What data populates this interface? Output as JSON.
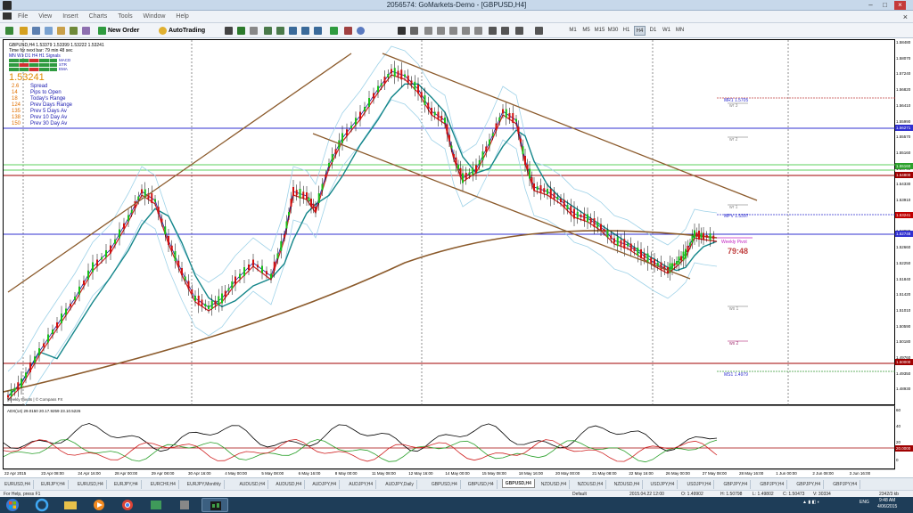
{
  "window": {
    "title": "2056574: GoMarkets-Demo - [GBPUSD,H4]"
  },
  "menu": [
    "File",
    "View",
    "Insert",
    "Charts",
    "Tools",
    "Window",
    "Help"
  ],
  "toolbar": {
    "new_order": "New Order",
    "autotrading": "AutoTrading",
    "timeframes": [
      "M1",
      "M5",
      "M15",
      "M30",
      "H1",
      "H4",
      "D1",
      "W1",
      "MN"
    ]
  },
  "chart_header": "GBPUSD,H4  1.53379 1.53399 1.53222 1.53241",
  "info_panel": {
    "time_line": "Time for next bar: 79 min 48 sec",
    "tf_row": "MN  W1  D1  H4  H1  Signals",
    "sig_macd": "MACD",
    "sig_str": "STR",
    "sig_ema": "EMA",
    "price": "1.53241",
    "rows": [
      {
        "val": "2.6",
        "label": "Spread",
        "color": "#1a1ab0"
      },
      {
        "val": "14",
        "label": "Pips to Open",
        "color": "#1a1ab0"
      },
      {
        "val": "18",
        "label": "Today's Range",
        "color": "#1a1ab0"
      },
      {
        "val": "124",
        "label": "Prev Days Range",
        "color": "#1a1ab0"
      },
      {
        "val": "135",
        "label": "Prev 5 Days Av",
        "color": "#1a1ab0"
      },
      {
        "val": "138",
        "label": "Prev 10 Day Av",
        "color": "#1a1ab0"
      },
      {
        "val": "150",
        "label": "Prev 30 Day Av",
        "color": "#1a1ab0"
      }
    ],
    "footer": "Weekly Pivots | © Compass FX"
  },
  "pivot_labels": {
    "mr1": "MR1  1.5705",
    "wr3": "wr 3",
    "wr2": "wr 2",
    "wr1": "wr 1",
    "mpv": "MPV  1.5397",
    "weekly_pivot": "Weekly Pivot",
    "countdown": "79:48",
    "ws1": "ws 1",
    "ws2": "ws 2",
    "ms1": "MS1  1.4979"
  },
  "indicator": {
    "label": "ADX(14) 29.0150  20.17.9259  23.10.5226",
    "scale": [
      "60",
      "40",
      "20",
      "0"
    ],
    "level": "20.0000"
  },
  "price_scale": [
    "1.58480",
    "1.58070",
    "1.57240",
    "1.56820",
    "1.56410",
    "1.55990",
    "1.55570",
    "1.55160",
    "1.54740",
    "1.54330",
    "1.53910",
    "1.53500",
    "1.53080",
    "1.52660",
    "1.52250",
    "1.51840",
    "1.51420",
    "1.51010",
    "1.50590",
    "1.50180",
    "1.49760",
    "1.49350",
    "1.48930"
  ],
  "price_boxes": [
    {
      "text": "1.56271",
      "color": "#3030d0"
    },
    {
      "text": "1.55160",
      "color": "#2aa02a"
    },
    {
      "text": "1.54800",
      "color": "#a00000"
    },
    {
      "text": "1.53241",
      "color": "#c00000"
    },
    {
      "text": "1.52748",
      "color": "#3030d0"
    },
    {
      "text": "1.50000",
      "color": "#a00000"
    }
  ],
  "time_axis": [
    "22 Apr 2015",
    "23 Apr 08:00",
    "24 Apr 16:00",
    "28 Apr 00:00",
    "29 Apr 08:00",
    "30 Apr 16:00",
    "4 May 00:00",
    "5 May 08:00",
    "6 May 16:00",
    "8 May 00:00",
    "11 May 08:00",
    "12 May 16:00",
    "14 May 00:00",
    "15 May 08:00",
    "18 May 16:00",
    "20 May 00:00",
    "21 May 08:00",
    "22 May 16:00",
    "26 May 00:00",
    "27 May 08:00",
    "28 May 16:00",
    "1 Jun 00:00",
    "2 Jun 08:00",
    "3 Jun 16:00"
  ],
  "tabs": [
    "EURUSD,H4",
    "EURJPY,H4",
    "EURUSD,H4",
    "EURJPY,H4",
    "EURCHF,H4",
    "EURJPY,Monthly",
    "AUDUSD,H4",
    "AUDUSD,H4",
    "AUDJPY,H4",
    "AUDJPY,H4",
    "AUDJPY,Daily",
    "GBPUSD,H4",
    "GBPUSD,H4",
    "GBPUSD,H4",
    "NZDUSD,H4",
    "NZDUSD,H4",
    "NZDUSD,H4",
    "USDJPY,H4",
    "USDJPY,H4",
    "GBPJPY,H4",
    "GBPJPY,H4",
    "GBPJPY,H4",
    "GBPJPY,H4"
  ],
  "active_tab": 13,
  "status": {
    "help": "For Help, press F1",
    "profile": "Default",
    "datetime": "2015.04.22 12:00",
    "open": "O: 1.49902",
    "high": "H: 1.50798",
    "low": "L: 1.49802",
    "close": "C: 1.50473",
    "volume": "V: 30334",
    "traffic": "2342/3 kb"
  },
  "taskbar": {
    "lang": "ENG",
    "time": "9:48 AM",
    "date": "4/06/2015"
  }
}
